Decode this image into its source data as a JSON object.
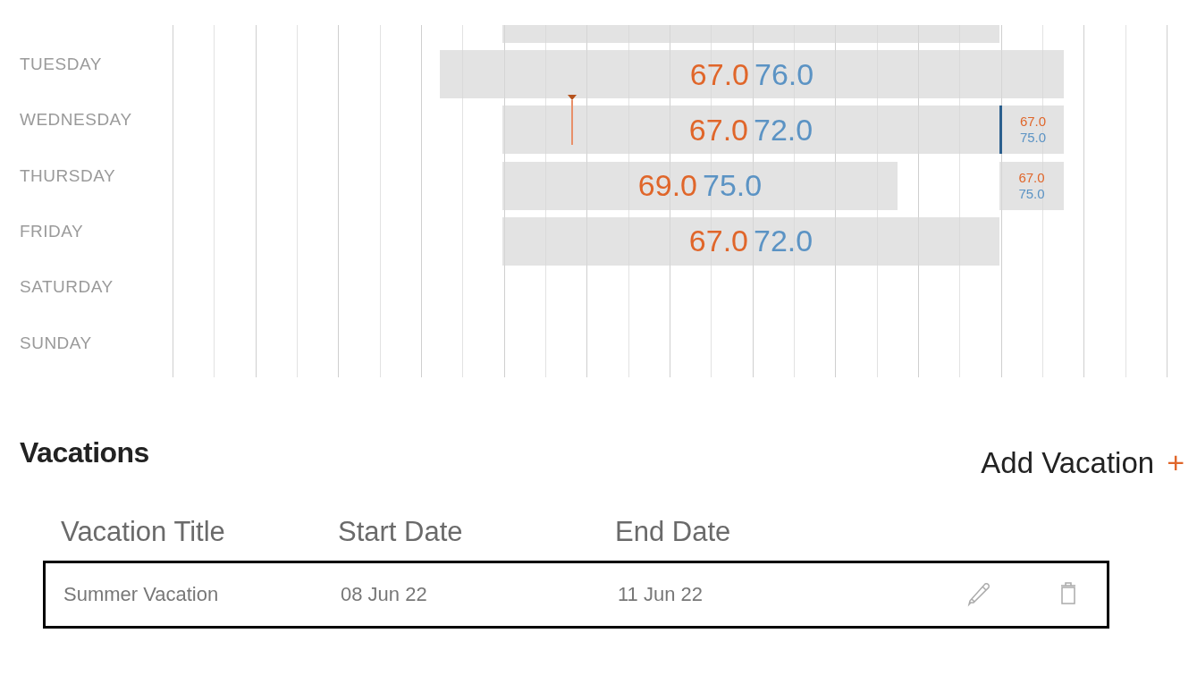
{
  "schedule": {
    "rows": [
      {
        "segments": [
          {
            "kind": "large"
          }
        ]
      },
      {
        "day": "TUESDAY",
        "segments": [
          {
            "kind": "large",
            "heat": "67.0",
            "cool": "76.0",
            "active": false
          }
        ]
      },
      {
        "day": "WEDNESDAY",
        "segments": [
          {
            "kind": "large",
            "heat": "67.0",
            "cool": "72.0",
            "active": false
          },
          {
            "kind": "small",
            "heat": "67.0",
            "cool": "75.0",
            "active": true
          }
        ],
        "marker": true
      },
      {
        "day": "THURSDAY",
        "segments": [
          {
            "kind": "large",
            "heat": "69.0",
            "cool": "75.0",
            "active": false
          },
          {
            "kind": "small",
            "heat": "67.0",
            "cool": "75.0",
            "active": false
          }
        ]
      },
      {
        "day": "FRIDAY",
        "segments": [
          {
            "kind": "large",
            "heat": "67.0",
            "cool": "72.0",
            "active": false
          }
        ]
      },
      {
        "day": "SATURDAY",
        "segments": []
      },
      {
        "day": "SUNDAY",
        "segments": []
      }
    ]
  },
  "vacations": {
    "title": "Vacations",
    "add_button": "Add Vacation",
    "add_icon": "+",
    "columns": [
      "Vacation Title",
      "Start Date",
      "End Date"
    ],
    "rows": [
      {
        "cells": [
          "Summer Vacation",
          "08 Jun 22",
          "11 Jun 22"
        ],
        "selected": true
      }
    ]
  }
}
